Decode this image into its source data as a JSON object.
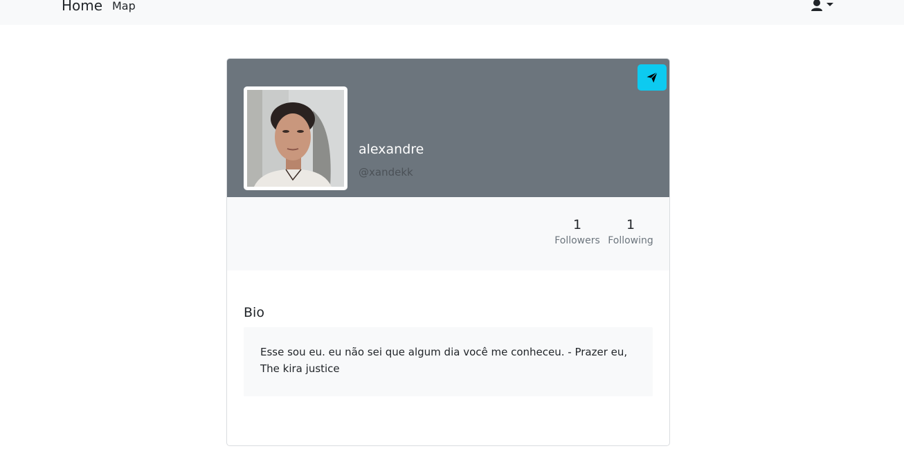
{
  "navbar": {
    "home_label": "Home",
    "map_label": "Map",
    "user_menu_icon": "user-icon"
  },
  "profile": {
    "display_name": "alexandre",
    "handle": "@xandekk",
    "send_icon": "paper-plane-icon",
    "accent_color": "#0dcaf0",
    "header_color": "#6c757d"
  },
  "stats": {
    "followers_count": "1",
    "followers_label": "Followers",
    "following_count": "1",
    "following_label": "Following"
  },
  "bio": {
    "title": "Bio",
    "text": "Esse sou eu. eu não sei que algum dia você me conheceu. - Prazer eu, The kira justice"
  }
}
